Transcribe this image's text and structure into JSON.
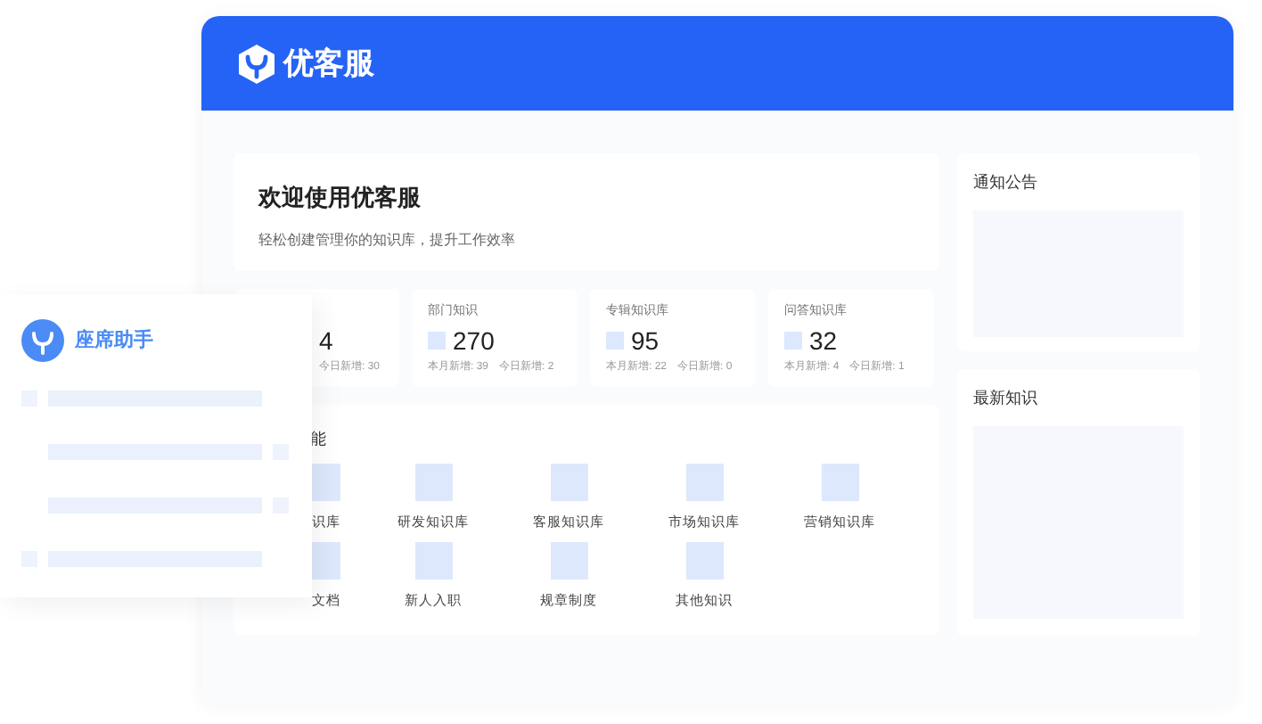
{
  "header": {
    "brand": "优客服"
  },
  "welcome": {
    "title": "欢迎使用优客服",
    "subtitle": "轻松创建管理你的知识库，提升工作效率"
  },
  "stats": [
    {
      "value": "4",
      "sub": [
        "今日新增: 30"
      ]
    },
    {
      "label": "部门知识",
      "value": "270",
      "sub": [
        "本月新增: 39",
        "今日新增: 2"
      ]
    },
    {
      "label": "专辑知识库",
      "value": "95",
      "sub": [
        "本月新增: 22",
        "今日新增: 0"
      ]
    },
    {
      "label": "问答知识库",
      "value": "32",
      "sub": [
        "本月新增: 4",
        "今日新增: 1"
      ]
    }
  ],
  "functions": {
    "title": "能",
    "rows": [
      [
        "识库",
        "研发知识库",
        "客服知识库",
        "市场知识库",
        "营销知识库"
      ],
      [
        "文档",
        "新人入职",
        "规章制度",
        "其他知识"
      ]
    ]
  },
  "side_cards": [
    {
      "title": "通知公告"
    },
    {
      "title": "最新知识"
    }
  ],
  "assistant": {
    "title": "座席助手",
    "rows": [
      {
        "lead": true,
        "tail": false
      },
      {
        "lead": false,
        "tail": true
      },
      {
        "lead": false,
        "tail": true
      },
      {
        "lead": true,
        "tail": false
      }
    ]
  }
}
